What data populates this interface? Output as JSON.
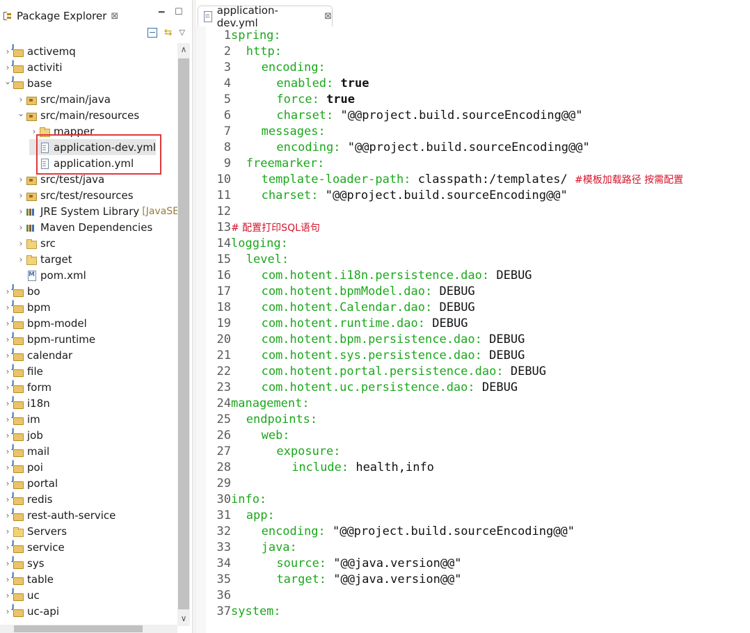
{
  "explorer": {
    "title": "Package Explorer",
    "close": "⊠",
    "tree": [
      {
        "label": "activemq",
        "icon": "project-icon",
        "expand": "collapsed",
        "level": 0
      },
      {
        "label": "activiti",
        "icon": "project-icon",
        "expand": "collapsed",
        "level": 0
      },
      {
        "label": "base",
        "icon": "project-icon",
        "expand": "expanded",
        "level": 0
      },
      {
        "label": "src/main/java",
        "icon": "package-folder-icon",
        "expand": "collapsed",
        "level": 1
      },
      {
        "label": "src/main/resources",
        "icon": "package-folder-icon",
        "expand": "expanded",
        "level": 1
      },
      {
        "label": "mapper",
        "icon": "folder-icon",
        "expand": "collapsed",
        "level": 2
      },
      {
        "label": "application-dev.yml",
        "icon": "file-icon",
        "expand": "none",
        "level": 2,
        "selected": true
      },
      {
        "label": "application.yml",
        "icon": "file-icon",
        "expand": "none",
        "level": 2
      },
      {
        "label": "src/test/java",
        "icon": "package-folder-icon",
        "expand": "collapsed",
        "level": 1
      },
      {
        "label": "src/test/resources",
        "icon": "package-folder-icon",
        "expand": "collapsed",
        "level": 1
      },
      {
        "label": "JRE System Library",
        "decoration": "[JavaSE",
        "icon": "library-icon",
        "expand": "collapsed",
        "level": 1
      },
      {
        "label": "Maven Dependencies",
        "icon": "library-icon",
        "expand": "collapsed",
        "level": 1
      },
      {
        "label": "src",
        "icon": "folder-icon",
        "expand": "collapsed",
        "level": 1
      },
      {
        "label": "target",
        "icon": "folder-icon",
        "expand": "collapsed",
        "level": 1
      },
      {
        "label": "pom.xml",
        "icon": "maven-file-icon",
        "expand": "none",
        "level": 1
      },
      {
        "label": "bo",
        "icon": "project-icon",
        "expand": "collapsed",
        "level": 0
      },
      {
        "label": "bpm",
        "icon": "project-icon",
        "expand": "collapsed",
        "level": 0
      },
      {
        "label": "bpm-model",
        "icon": "project-icon",
        "expand": "collapsed",
        "level": 0
      },
      {
        "label": "bpm-runtime",
        "icon": "project-icon",
        "expand": "collapsed",
        "level": 0
      },
      {
        "label": "calendar",
        "icon": "project-icon",
        "expand": "collapsed",
        "level": 0
      },
      {
        "label": "file",
        "icon": "project-icon",
        "expand": "collapsed",
        "level": 0
      },
      {
        "label": "form",
        "icon": "project-icon",
        "expand": "collapsed",
        "level": 0
      },
      {
        "label": "i18n",
        "icon": "project-icon",
        "expand": "collapsed",
        "level": 0
      },
      {
        "label": "im",
        "icon": "project-icon",
        "expand": "collapsed",
        "level": 0
      },
      {
        "label": "job",
        "icon": "project-icon",
        "expand": "collapsed",
        "level": 0
      },
      {
        "label": "mail",
        "icon": "project-icon",
        "expand": "collapsed",
        "level": 0
      },
      {
        "label": "poi",
        "icon": "project-icon",
        "expand": "collapsed",
        "level": 0
      },
      {
        "label": "portal",
        "icon": "project-icon",
        "expand": "collapsed",
        "level": 0
      },
      {
        "label": "redis",
        "icon": "project-icon",
        "expand": "collapsed",
        "level": 0
      },
      {
        "label": "rest-auth-service",
        "icon": "project-icon",
        "expand": "collapsed",
        "level": 0
      },
      {
        "label": "Servers",
        "icon": "folder-icon",
        "expand": "collapsed",
        "level": 0
      },
      {
        "label": "service",
        "icon": "project-icon",
        "expand": "collapsed",
        "level": 0
      },
      {
        "label": "sys",
        "icon": "project-icon",
        "expand": "collapsed",
        "level": 0
      },
      {
        "label": "table",
        "icon": "project-icon",
        "expand": "collapsed",
        "level": 0
      },
      {
        "label": "uc",
        "icon": "project-icon",
        "expand": "collapsed",
        "level": 0
      },
      {
        "label": "uc-api",
        "icon": "project-icon",
        "expand": "collapsed",
        "level": 0
      }
    ]
  },
  "editor": {
    "tab_title": "application-dev.yml",
    "close": "⊠",
    "lines": [
      {
        "n": "1",
        "indent": 0,
        "key": "spring:",
        "val": ""
      },
      {
        "n": "2",
        "indent": 2,
        "key": "http:",
        "val": ""
      },
      {
        "n": "3",
        "indent": 4,
        "key": "encoding:",
        "val": ""
      },
      {
        "n": "4",
        "indent": 6,
        "key": "enabled:",
        "val": "true",
        "bold": true
      },
      {
        "n": "5",
        "indent": 6,
        "key": "force:",
        "val": "true",
        "bold": true
      },
      {
        "n": "6",
        "indent": 6,
        "key": "charset:",
        "val": "\"@@project.build.sourceEncoding@@\""
      },
      {
        "n": "7",
        "indent": 4,
        "key": "messages:",
        "val": ""
      },
      {
        "n": "8",
        "indent": 6,
        "key": "encoding:",
        "val": "\"@@project.build.sourceEncoding@@\""
      },
      {
        "n": "9",
        "indent": 2,
        "key": "freemarker:",
        "val": ""
      },
      {
        "n": "10",
        "indent": 4,
        "key": "template-loader-path:",
        "val": "classpath:/templates/",
        "comment": "#模板加载路径 按需配置"
      },
      {
        "n": "11",
        "indent": 4,
        "key": "charset:",
        "val": "\"@@project.build.sourceEncoding@@\""
      },
      {
        "n": "12",
        "indent": 0,
        "key": "",
        "val": ""
      },
      {
        "n": "13",
        "indent": 0,
        "key": "",
        "val": "",
        "comment": "# 配置打印SQL语句"
      },
      {
        "n": "14",
        "indent": 0,
        "key": "logging:",
        "val": ""
      },
      {
        "n": "15",
        "indent": 2,
        "key": "level:",
        "val": ""
      },
      {
        "n": "16",
        "indent": 4,
        "key": "com.hotent.i18n.persistence.dao:",
        "val": "DEBUG"
      },
      {
        "n": "17",
        "indent": 4,
        "key": "com.hotent.bpmModel.dao:",
        "val": "DEBUG"
      },
      {
        "n": "18",
        "indent": 4,
        "key": "com.hotent.Calendar.dao:",
        "val": "DEBUG"
      },
      {
        "n": "19",
        "indent": 4,
        "key": "com.hotent.runtime.dao:",
        "val": "DEBUG"
      },
      {
        "n": "20",
        "indent": 4,
        "key": "com.hotent.bpm.persistence.dao:",
        "val": "DEBUG"
      },
      {
        "n": "21",
        "indent": 4,
        "key": "com.hotent.sys.persistence.dao:",
        "val": "DEBUG"
      },
      {
        "n": "22",
        "indent": 4,
        "key": "com.hotent.portal.persistence.dao:",
        "val": "DEBUG"
      },
      {
        "n": "23",
        "indent": 4,
        "key": "com.hotent.uc.persistence.dao:",
        "val": "DEBUG"
      },
      {
        "n": "24",
        "indent": 0,
        "key": "management:",
        "val": ""
      },
      {
        "n": "25",
        "indent": 2,
        "key": "endpoints:",
        "val": ""
      },
      {
        "n": "26",
        "indent": 4,
        "key": "web:",
        "val": ""
      },
      {
        "n": "27",
        "indent": 6,
        "key": "exposure:",
        "val": ""
      },
      {
        "n": "28",
        "indent": 8,
        "key": "include:",
        "val": "health,info"
      },
      {
        "n": "29",
        "indent": 0,
        "key": "",
        "val": ""
      },
      {
        "n": "30",
        "indent": 0,
        "key": "info:",
        "val": ""
      },
      {
        "n": "31",
        "indent": 2,
        "key": "app:",
        "val": ""
      },
      {
        "n": "32",
        "indent": 4,
        "key": "encoding:",
        "val": "\"@@project.build.sourceEncoding@@\""
      },
      {
        "n": "33",
        "indent": 4,
        "key": "java:",
        "val": ""
      },
      {
        "n": "34",
        "indent": 6,
        "key": "source:",
        "val": "\"@@java.version@@\""
      },
      {
        "n": "35",
        "indent": 6,
        "key": "target:",
        "val": "\"@@java.version@@\""
      },
      {
        "n": "36",
        "indent": 0,
        "key": "",
        "val": ""
      },
      {
        "n": "37",
        "indent": 0,
        "key": "system:",
        "val": ""
      }
    ]
  },
  "colors": {
    "yaml_key": "#1aa81a",
    "comment": "#d4142b",
    "highlight_box": "#e0383b"
  }
}
